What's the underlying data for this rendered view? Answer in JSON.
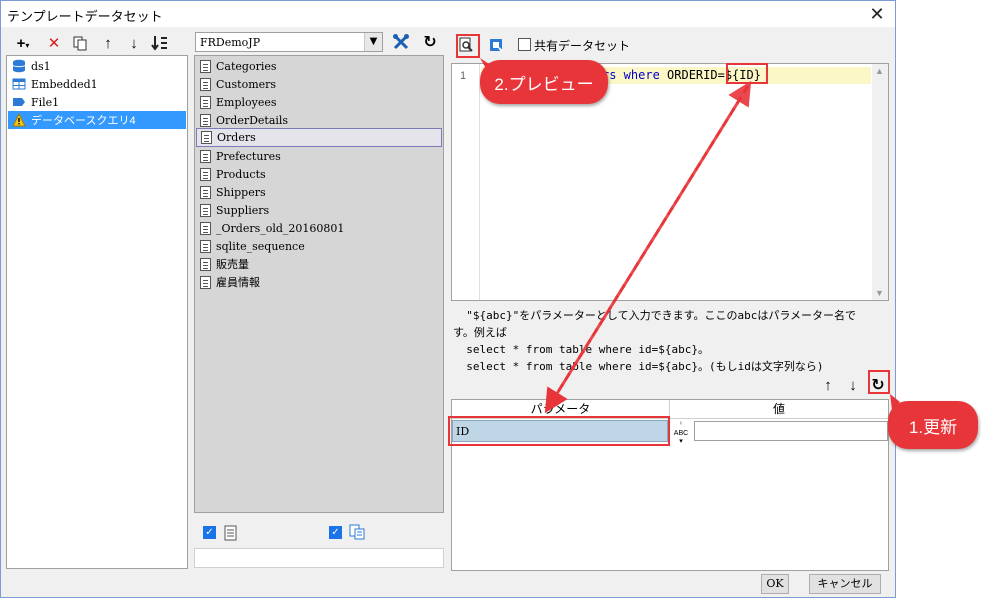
{
  "window": {
    "title": "テンプレートデータセット"
  },
  "datasets": [
    {
      "label": "ds1",
      "icon": "database-icon"
    },
    {
      "label": "Embedded1",
      "icon": "embedded-table-icon"
    },
    {
      "label": "File1",
      "icon": "file-icon"
    },
    {
      "label": "データベースクエリ4",
      "icon": "warning-icon",
      "selected": true
    }
  ],
  "database": {
    "selected": "FRDemoJP"
  },
  "tables": [
    "Categories",
    "Customers",
    "Employees",
    "OrderDetails",
    "Orders",
    "Prefectures",
    "Products",
    "Shippers",
    "Suppliers",
    "_Orders_old_20160801",
    "sqlite_sequence",
    "販売量",
    "雇員情報"
  ],
  "selected_table": "Orders",
  "editor": {
    "shared_label": "共有データセット",
    "line_number": "1",
    "sql_kw_visible": "rs where",
    "sql_column": " ORDERID=",
    "sql_param": "${ID}"
  },
  "help": {
    "line1": "  \"${abc}\"をパラメーターとして入力できます。ここのabcはパラメーター名で",
    "line2": "す。例えば",
    "line3": "  select * from table where id=${abc}。",
    "line4": "  select * from table where id=${abc}。(もしidは文字列なら)"
  },
  "params": {
    "header_name": "パラメータ",
    "header_value": "値",
    "rows": [
      {
        "name": "ID",
        "type": "ABC",
        "value": ""
      }
    ]
  },
  "buttons": {
    "ok": "OK",
    "cancel": "キャンセル"
  },
  "annotations": {
    "preview": "2.プレビュー",
    "refresh": "1.更新"
  },
  "colors": {
    "accent_red": "#e8353a",
    "selection_blue": "#3399ff",
    "param_row": "#bfd6e6"
  }
}
